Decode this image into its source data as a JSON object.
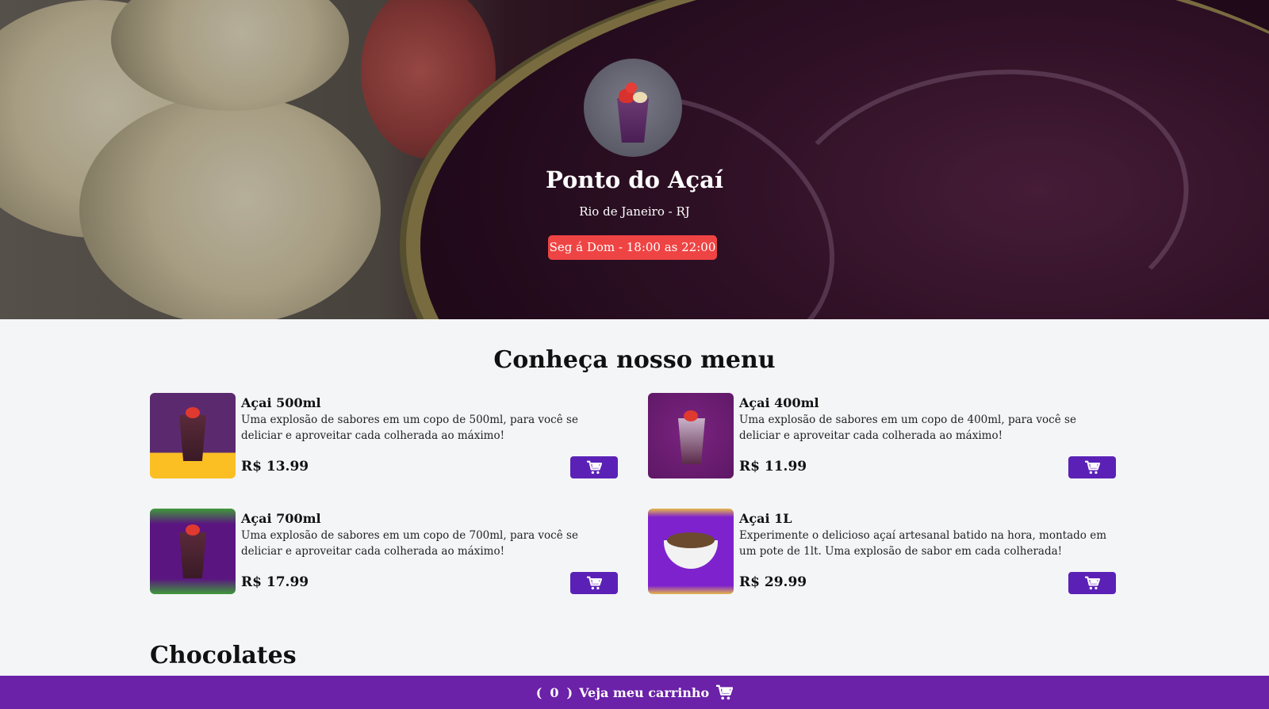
{
  "store": {
    "name": "Ponto do Açaí",
    "location": "Rio de Janeiro - RJ",
    "hours": "Seg á Dom - 18:00 as 22:00"
  },
  "menu": {
    "title": "Conheça nosso menu",
    "items": [
      {
        "name": "Açai 500ml",
        "description": "Uma explosão de sabores em um copo de 500ml, para você se deliciar e aproveitar cada colherada ao máximo!",
        "price": "R$ 13.99",
        "thumb_colors": [
          "#5b2a6e",
          "#fbbf24"
        ]
      },
      {
        "name": "Açai 400ml",
        "description": "Uma explosão de sabores em um copo de 400ml, para você se deliciar e aproveitar cada colherada ao máximo!",
        "price": "R$ 11.99",
        "thumb_colors": [
          "#6b1a6e",
          "#6b1a6e"
        ]
      },
      {
        "name": "Açai 700ml",
        "description": "Uma explosão de sabores em um copo de 700ml, para você se deliciar e aproveitar cada colherada ao máximo!",
        "price": "R$ 17.99",
        "thumb_colors": [
          "#5a1580",
          "#3f9a3a"
        ]
      },
      {
        "name": "Açai 1L",
        "description": "Experimente o delicioso açaí artesanal batido na hora, montado em um pote de 1lt. Uma explosão de sabor em cada colherada!",
        "price": "R$ 29.99",
        "thumb_colors": [
          "#7e22ce",
          "#e6b84a"
        ]
      }
    ]
  },
  "sections": {
    "chocolates": "Chocolates"
  },
  "footer": {
    "open_paren": "(",
    "count": "0",
    "close_paren": ")",
    "label": "Veja meu carrinho",
    "icon": "cart-icon"
  },
  "colors": {
    "accent": "#5b21b6",
    "footer": "#6b21a8",
    "hours_badge": "#ef4444",
    "background": "#f4f5f7"
  }
}
